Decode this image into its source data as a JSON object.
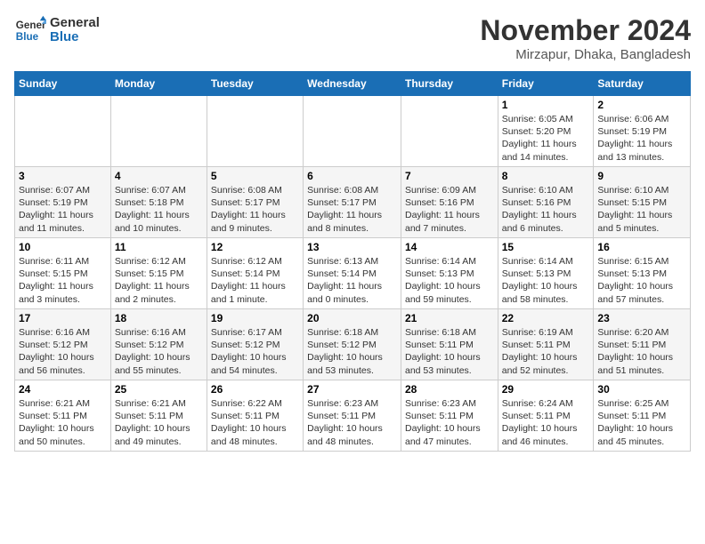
{
  "header": {
    "logo_line1": "General",
    "logo_line2": "Blue",
    "month_year": "November 2024",
    "location": "Mirzapur, Dhaka, Bangladesh"
  },
  "days_of_week": [
    "Sunday",
    "Monday",
    "Tuesday",
    "Wednesday",
    "Thursday",
    "Friday",
    "Saturday"
  ],
  "weeks": [
    [
      {
        "day": "",
        "info": ""
      },
      {
        "day": "",
        "info": ""
      },
      {
        "day": "",
        "info": ""
      },
      {
        "day": "",
        "info": ""
      },
      {
        "day": "",
        "info": ""
      },
      {
        "day": "1",
        "info": "Sunrise: 6:05 AM\nSunset: 5:20 PM\nDaylight: 11 hours and 14 minutes."
      },
      {
        "day": "2",
        "info": "Sunrise: 6:06 AM\nSunset: 5:19 PM\nDaylight: 11 hours and 13 minutes."
      }
    ],
    [
      {
        "day": "3",
        "info": "Sunrise: 6:07 AM\nSunset: 5:19 PM\nDaylight: 11 hours and 11 minutes."
      },
      {
        "day": "4",
        "info": "Sunrise: 6:07 AM\nSunset: 5:18 PM\nDaylight: 11 hours and 10 minutes."
      },
      {
        "day": "5",
        "info": "Sunrise: 6:08 AM\nSunset: 5:17 PM\nDaylight: 11 hours and 9 minutes."
      },
      {
        "day": "6",
        "info": "Sunrise: 6:08 AM\nSunset: 5:17 PM\nDaylight: 11 hours and 8 minutes."
      },
      {
        "day": "7",
        "info": "Sunrise: 6:09 AM\nSunset: 5:16 PM\nDaylight: 11 hours and 7 minutes."
      },
      {
        "day": "8",
        "info": "Sunrise: 6:10 AM\nSunset: 5:16 PM\nDaylight: 11 hours and 6 minutes."
      },
      {
        "day": "9",
        "info": "Sunrise: 6:10 AM\nSunset: 5:15 PM\nDaylight: 11 hours and 5 minutes."
      }
    ],
    [
      {
        "day": "10",
        "info": "Sunrise: 6:11 AM\nSunset: 5:15 PM\nDaylight: 11 hours and 3 minutes."
      },
      {
        "day": "11",
        "info": "Sunrise: 6:12 AM\nSunset: 5:15 PM\nDaylight: 11 hours and 2 minutes."
      },
      {
        "day": "12",
        "info": "Sunrise: 6:12 AM\nSunset: 5:14 PM\nDaylight: 11 hours and 1 minute."
      },
      {
        "day": "13",
        "info": "Sunrise: 6:13 AM\nSunset: 5:14 PM\nDaylight: 11 hours and 0 minutes."
      },
      {
        "day": "14",
        "info": "Sunrise: 6:14 AM\nSunset: 5:13 PM\nDaylight: 10 hours and 59 minutes."
      },
      {
        "day": "15",
        "info": "Sunrise: 6:14 AM\nSunset: 5:13 PM\nDaylight: 10 hours and 58 minutes."
      },
      {
        "day": "16",
        "info": "Sunrise: 6:15 AM\nSunset: 5:13 PM\nDaylight: 10 hours and 57 minutes."
      }
    ],
    [
      {
        "day": "17",
        "info": "Sunrise: 6:16 AM\nSunset: 5:12 PM\nDaylight: 10 hours and 56 minutes."
      },
      {
        "day": "18",
        "info": "Sunrise: 6:16 AM\nSunset: 5:12 PM\nDaylight: 10 hours and 55 minutes."
      },
      {
        "day": "19",
        "info": "Sunrise: 6:17 AM\nSunset: 5:12 PM\nDaylight: 10 hours and 54 minutes."
      },
      {
        "day": "20",
        "info": "Sunrise: 6:18 AM\nSunset: 5:12 PM\nDaylight: 10 hours and 53 minutes."
      },
      {
        "day": "21",
        "info": "Sunrise: 6:18 AM\nSunset: 5:11 PM\nDaylight: 10 hours and 53 minutes."
      },
      {
        "day": "22",
        "info": "Sunrise: 6:19 AM\nSunset: 5:11 PM\nDaylight: 10 hours and 52 minutes."
      },
      {
        "day": "23",
        "info": "Sunrise: 6:20 AM\nSunset: 5:11 PM\nDaylight: 10 hours and 51 minutes."
      }
    ],
    [
      {
        "day": "24",
        "info": "Sunrise: 6:21 AM\nSunset: 5:11 PM\nDaylight: 10 hours and 50 minutes."
      },
      {
        "day": "25",
        "info": "Sunrise: 6:21 AM\nSunset: 5:11 PM\nDaylight: 10 hours and 49 minutes."
      },
      {
        "day": "26",
        "info": "Sunrise: 6:22 AM\nSunset: 5:11 PM\nDaylight: 10 hours and 48 minutes."
      },
      {
        "day": "27",
        "info": "Sunrise: 6:23 AM\nSunset: 5:11 PM\nDaylight: 10 hours and 48 minutes."
      },
      {
        "day": "28",
        "info": "Sunrise: 6:23 AM\nSunset: 5:11 PM\nDaylight: 10 hours and 47 minutes."
      },
      {
        "day": "29",
        "info": "Sunrise: 6:24 AM\nSunset: 5:11 PM\nDaylight: 10 hours and 46 minutes."
      },
      {
        "day": "30",
        "info": "Sunrise: 6:25 AM\nSunset: 5:11 PM\nDaylight: 10 hours and 45 minutes."
      }
    ]
  ]
}
